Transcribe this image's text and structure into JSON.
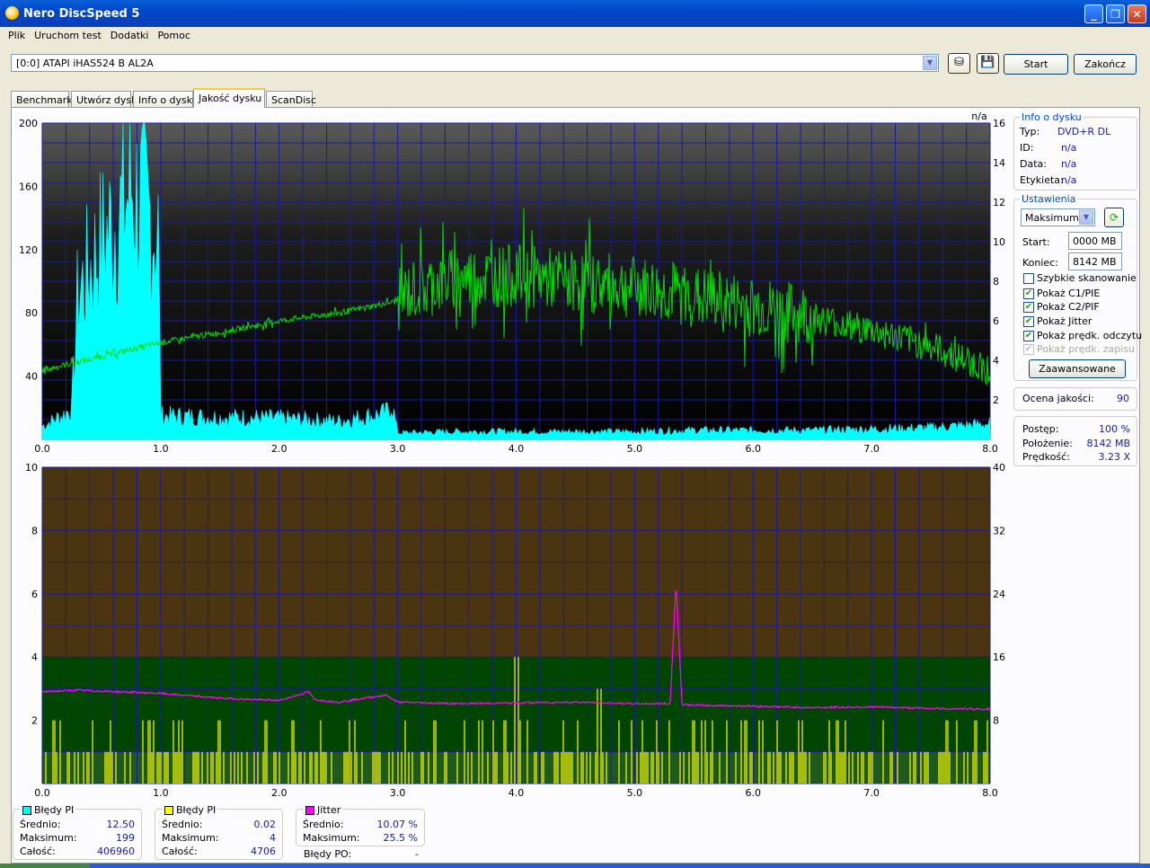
{
  "window": {
    "title": "Nero DiscSpeed 5"
  },
  "menu": [
    "Plik",
    "Uruchom test",
    "Dodatki",
    "Pomoc"
  ],
  "toolbar": {
    "drive": "[0:0]   ATAPI iHAS524   B AL2A",
    "start_label": "Start",
    "end_label": "Zakończ"
  },
  "tabs": [
    "Benchmark",
    "Utwórz dysk",
    "Info o dysku",
    "Jakość dysku",
    "ScanDisc"
  ],
  "active_tab": "Jakość dysku",
  "disc_info": {
    "title": "Info o dysku",
    "rows": [
      {
        "label": "Typ:",
        "value": "DVD+R DL"
      },
      {
        "label": "ID:",
        "value": "n/a"
      },
      {
        "label": "Data:",
        "value": "n/a"
      },
      {
        "label": "Etykieta:",
        "value": "n/a"
      }
    ]
  },
  "settings": {
    "title": "Ustawienia",
    "mode": "Maksimum",
    "start_label": "Start:",
    "start_value": "0000 MB",
    "end_label": "Koniec:",
    "end_value": "8142 MB",
    "checkboxes": [
      {
        "label": "Szybkie skanowanie",
        "checked": false,
        "disabled": false
      },
      {
        "label": "Pokaż C1/PIE",
        "checked": true,
        "disabled": false
      },
      {
        "label": "Pokaż C2/PIF",
        "checked": true,
        "disabled": false
      },
      {
        "label": "Pokaż Jitter",
        "checked": true,
        "disabled": false
      },
      {
        "label": "Pokaż prędk. odczytu",
        "checked": true,
        "disabled": false
      },
      {
        "label": "Pokaż prędk. zapisu",
        "checked": true,
        "disabled": true
      }
    ],
    "advanced_label": "Zaawansowane"
  },
  "quality": {
    "label": "Ocena jakości:",
    "value": "90"
  },
  "progress": [
    {
      "label": "Postęp:",
      "value": "100 %"
    },
    {
      "label": "Położenie:",
      "value": "8142 MB"
    },
    {
      "label": "Prędkość:",
      "value": "3.23 X"
    }
  ],
  "stats": [
    {
      "title": "Błędy PI",
      "color": "#00ffff",
      "rows": [
        {
          "label": "Średnio:",
          "value": "12.50"
        },
        {
          "label": "Maksimum:",
          "value": "199"
        },
        {
          "label": "Całość:",
          "value": "406960"
        }
      ]
    },
    {
      "title": "Błędy PI",
      "color": "#ffff00",
      "rows": [
        {
          "label": "Średnio:",
          "value": "0.02"
        },
        {
          "label": "Maksimum:",
          "value": "4"
        },
        {
          "label": "Całość:",
          "value": "4706"
        }
      ]
    },
    {
      "title": "Jitter",
      "color": "#ff00ff",
      "rows": [
        {
          "label": "Średnio:",
          "value": "10.07 %"
        },
        {
          "label": "Maksimum:",
          "value": "25.5 %"
        }
      ]
    }
  ],
  "po_errors": {
    "label": "Błędy PO:",
    "value": "-"
  },
  "chart_data": [
    {
      "type": "area",
      "title": "",
      "x_ticks": [
        "0.0",
        "1.0",
        "2.0",
        "3.0",
        "4.0",
        "5.0",
        "6.0",
        "7.0",
        "8.0"
      ],
      "xlim": [
        0,
        8
      ],
      "ylim": [
        0,
        200
      ],
      "y_ticks_left": [
        "200",
        "160",
        "120",
        "80",
        "40"
      ],
      "y2lim": [
        0,
        16
      ],
      "y_ticks_right": [
        "16",
        "14",
        "12",
        "10",
        "8",
        "6",
        "4",
        "2"
      ],
      "y2_top_label": "n/a",
      "grid": true,
      "series": [
        {
          "name": "",
          "color": "#00ffff",
          "kind": "area",
          "x": [
            0.0,
            0.1,
            0.2,
            0.25,
            0.3,
            0.4,
            0.5,
            0.6,
            0.7,
            0.75,
            0.8,
            0.9,
            0.98,
            1.0,
            1.5,
            2.0,
            2.5,
            2.9,
            2.95,
            3.0,
            3.5,
            4.0,
            4.5,
            5.0,
            5.5,
            6.0,
            6.5,
            7.0,
            7.5,
            8.0
          ],
          "y": [
            10,
            15,
            20,
            25,
            110,
            130,
            150,
            165,
            180,
            195,
            185,
            170,
            160,
            18,
            17,
            16,
            14,
            20,
            28,
            5,
            6,
            6,
            6,
            6,
            7,
            7,
            7,
            8,
            9,
            12
          ]
        },
        {
          "name": "",
          "color": "#00dd00",
          "kind": "line",
          "axis": "right",
          "x": [
            0.0,
            0.5,
            1.0,
            1.5,
            2.0,
            2.5,
            3.0,
            3.1,
            3.5,
            4.0,
            4.5,
            5.0,
            5.5,
            6.0,
            6.5,
            7.0,
            7.5,
            8.0
          ],
          "y": [
            3.5,
            4.2,
            4.9,
            5.4,
            6.0,
            6.4,
            7.0,
            7.5,
            8.2,
            8.3,
            8.0,
            7.7,
            7.2,
            6.7,
            6.2,
            5.5,
            4.7,
            3.5
          ]
        }
      ]
    },
    {
      "type": "bar",
      "title": "",
      "x_ticks": [
        "0.0",
        "1.0",
        "2.0",
        "3.0",
        "4.0",
        "5.0",
        "6.0",
        "7.0",
        "8.0"
      ],
      "xlim": [
        0,
        8
      ],
      "ylim": [
        0,
        10
      ],
      "y_ticks_left": [
        "10",
        "8",
        "6",
        "4",
        "2"
      ],
      "y2lim": [
        0,
        40
      ],
      "y_ticks_right": [
        "40",
        "32",
        "24",
        "16",
        "8"
      ],
      "grid": true,
      "series": [
        {
          "name": "",
          "color": "#ffff00",
          "kind": "bars",
          "x": [
            0.1,
            0.3,
            0.5,
            0.7,
            0.9,
            1.1,
            1.3,
            1.5,
            1.7,
            1.9,
            2.1,
            2.3,
            2.5,
            2.7,
            2.9,
            3.1,
            3.3,
            3.5,
            3.7,
            3.9,
            4.0,
            4.1,
            4.3,
            4.5,
            4.7,
            4.9,
            5.1,
            5.3,
            5.5,
            5.7,
            5.9,
            6.1,
            6.3,
            6.5,
            6.7,
            6.9,
            7.1,
            7.3,
            7.5,
            7.7,
            7.9
          ],
          "y": [
            2,
            1,
            2,
            1,
            2,
            2,
            1,
            2,
            1,
            2,
            2,
            1,
            2,
            1,
            2,
            1,
            2,
            1,
            2,
            2,
            4,
            2,
            2,
            2,
            3,
            2,
            1,
            2,
            2,
            1,
            2,
            2,
            1,
            2,
            2,
            1,
            2,
            2,
            1,
            2,
            2
          ]
        },
        {
          "name": "",
          "color": "#ff00ff",
          "kind": "line",
          "axis": "right",
          "x": [
            0.0,
            0.3,
            1.0,
            1.5,
            2.0,
            2.25,
            2.3,
            2.5,
            2.9,
            3.0,
            3.5,
            4.0,
            4.5,
            5.0,
            5.3,
            5.35,
            5.4,
            5.5,
            6.0,
            6.5,
            7.0,
            7.5,
            8.0
          ],
          "y": [
            11.6,
            11.8,
            11.4,
            10.8,
            10.5,
            11.6,
            10.6,
            10.3,
            11.2,
            10.3,
            10.1,
            10.2,
            10.3,
            10.1,
            10.1,
            25.5,
            10.0,
            9.9,
            9.8,
            9.6,
            9.7,
            9.5,
            9.4
          ]
        }
      ]
    }
  ]
}
